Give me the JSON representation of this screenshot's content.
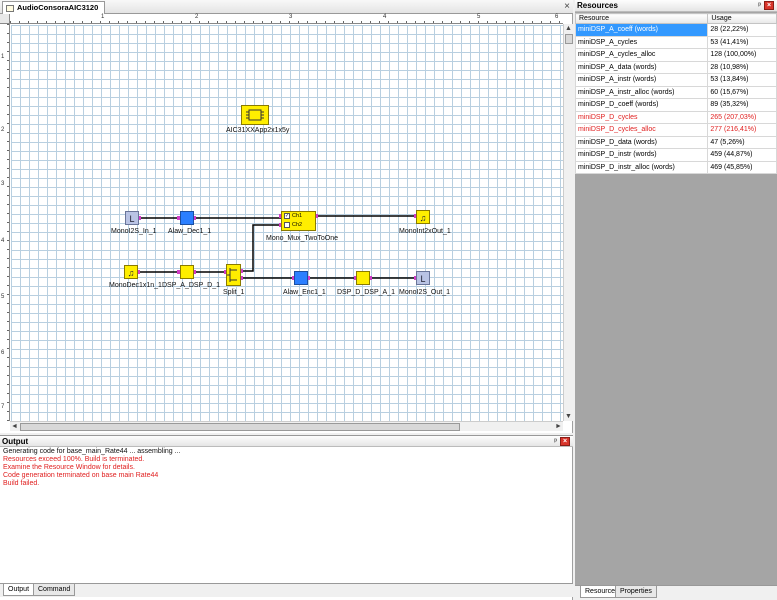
{
  "designer": {
    "tab_title": "AudioConsoraAIC3120",
    "close_glyph": "×",
    "ruler_top_numbers": [
      "1",
      "2",
      "3",
      "4",
      "5",
      "6"
    ],
    "ruler_left_numbers": [
      "1",
      "2",
      "3",
      "4",
      "5",
      "6",
      "7"
    ],
    "scroll_up": "▲",
    "scroll_down": "▼",
    "scroll_left": "◄",
    "scroll_right": "►",
    "blocks": {
      "aic": "AIC31XXApp2x1x5y",
      "mono_i2s_in": "MonoI2S_In_1",
      "alaw_dec": "Alaw_Dec1_1",
      "mono_mux": "Mono_Mux_TwoToOne",
      "mux_ch1": "Ch1",
      "mux_ch2": "Ch2",
      "mono_int_out": "MonoInt2xOut_1",
      "mono_dec_in": "MonoDec1x1n_1",
      "dsp_a_dsp_d": "DSP_A_DSP_D_1",
      "split": "Split_1",
      "alaw_enc": "Alaw_Enc1_1",
      "dsp_d_dsp_a": "DSP_D_DSP_A_1",
      "mono_i2s_out": "MonoI2S_Out_1"
    },
    "block_glyphs": {
      "gray_block": "L",
      "audio_block": "♫"
    },
    "colors": {
      "grid": "#b8cfe0",
      "block_yellow": "#ffee00",
      "block_blue": "#2b7fff",
      "block_gray": "#b9c3e4",
      "wire": "#000000",
      "port": "#d23cc8"
    }
  },
  "output": {
    "title": "Output",
    "pin_glyph": "ᵖ",
    "close_glyph": "×",
    "lines": [
      {
        "text": "Generating code for base_main_Rate44 ... assembling ...",
        "kind": "ok"
      },
      {
        "text": "Resources exceed 100%. Build is terminated.",
        "kind": "err"
      },
      {
        "text": "Examine the Resource Window for details.",
        "kind": "err"
      },
      {
        "text": "Code generation terminated on base main Rate44",
        "kind": "err"
      },
      {
        "text": "Build failed.",
        "kind": "err"
      }
    ],
    "tabs": [
      "Output",
      "Command"
    ]
  },
  "resources": {
    "title": "Resources",
    "pin_glyph": "ᵖ",
    "close_glyph": "×",
    "columns": [
      "Resource",
      "Usage"
    ],
    "rows": [
      {
        "resource": "miniDSP_A_coeff (words)",
        "usage": "28  (22,22%)",
        "state": "selected"
      },
      {
        "resource": "miniDSP_A_cycles",
        "usage": "53  (41,41%)",
        "state": "normal"
      },
      {
        "resource": "miniDSP_A_cycles_alloc",
        "usage": "128  (100,00%)",
        "state": "normal"
      },
      {
        "resource": "miniDSP_A_data (words)",
        "usage": "28  (10,98%)",
        "state": "normal"
      },
      {
        "resource": "miniDSP_A_instr (words)",
        "usage": "53  (13,84%)",
        "state": "normal"
      },
      {
        "resource": "miniDSP_A_instr_alloc (words)",
        "usage": "60  (15,67%)",
        "state": "normal"
      },
      {
        "resource": "miniDSP_D_coeff (words)",
        "usage": "89  (35,32%)",
        "state": "normal"
      },
      {
        "resource": "miniDSP_D_cycles",
        "usage": "265  (207,03%)",
        "state": "error"
      },
      {
        "resource": "miniDSP_D_cycles_alloc",
        "usage": "277  (216,41%)",
        "state": "error"
      },
      {
        "resource": "miniDSP_D_data (words)",
        "usage": "47  (5,26%)",
        "state": "normal"
      },
      {
        "resource": "miniDSP_D_instr (words)",
        "usage": "459  (44,87%)",
        "state": "normal"
      },
      {
        "resource": "miniDSP_D_instr_alloc (words)",
        "usage": "469  (45,85%)",
        "state": "normal"
      }
    ],
    "tabs": [
      "Resources",
      "Properties"
    ]
  }
}
